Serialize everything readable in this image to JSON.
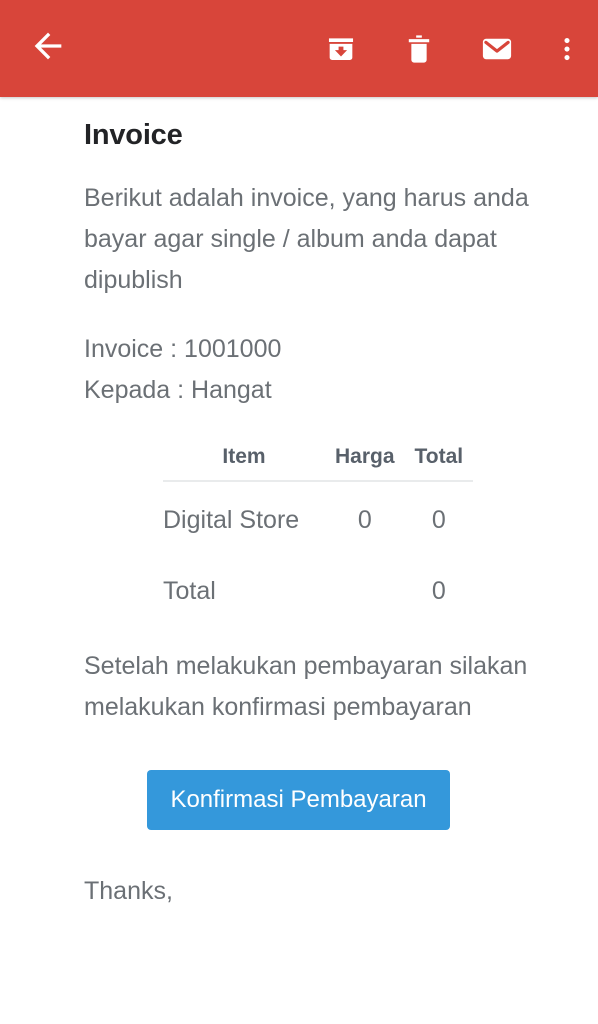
{
  "toolbar": {
    "background_color": "#d8453a",
    "back_label": "Back",
    "actions": [
      {
        "name": "archive",
        "label": "Archive"
      },
      {
        "name": "delete",
        "label": "Delete"
      },
      {
        "name": "mark-unread",
        "label": "Mark as unread"
      },
      {
        "name": "more-options",
        "label": "More options"
      }
    ]
  },
  "email": {
    "subject": "Invoice",
    "intro": "Berikut adalah invoice, yang harus anda bayar agar single / album anda dapat dipublish",
    "invoice_line": "Invoice : 1001000",
    "recipient_line": "Kepada : Hangat",
    "note": "Setelah melakukan pembayaran silakan melakukan konfirmasi pembayaran",
    "signoff": "Thanks,"
  },
  "invoice_table": {
    "headers": [
      "Item",
      "Harga",
      "Total"
    ],
    "rows": [
      {
        "item": "Digital Store",
        "harga": "0",
        "total": "0"
      },
      {
        "item": "Total",
        "harga": "",
        "total": "0"
      }
    ]
  },
  "cta": {
    "label": "Konfirmasi Pembayaran",
    "background_color": "#3498db",
    "text_color": "#ffffff"
  }
}
